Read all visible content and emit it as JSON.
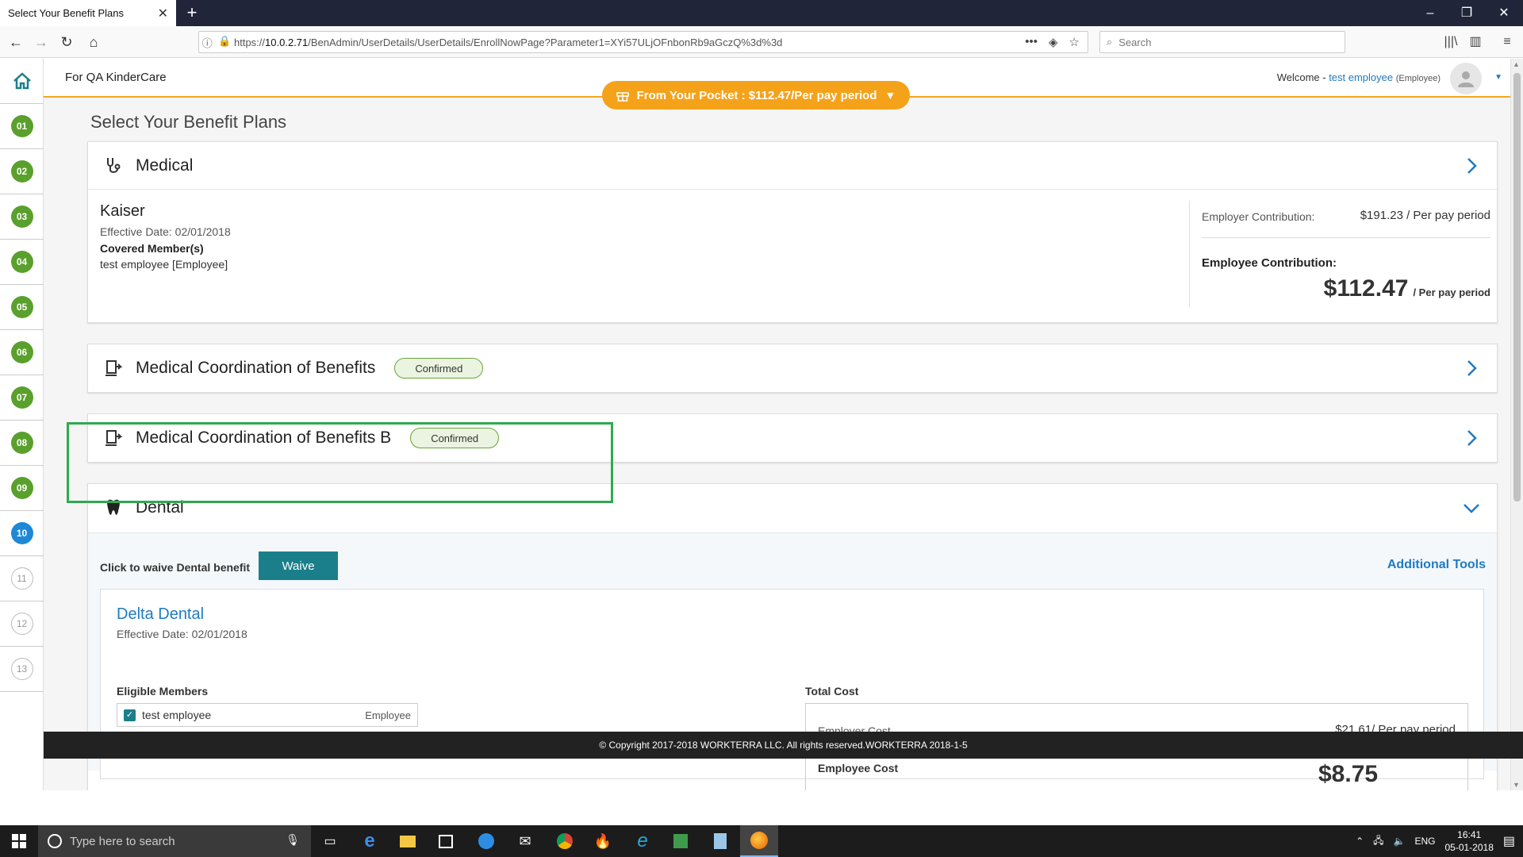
{
  "browser": {
    "tab_title": "Select Your Benefit Plans",
    "url_prefix": "https://",
    "url_host": "10.0.2.71",
    "url_path": "/BenAdmin/UserDetails/UserDetails/EnrollNowPage?Parameter1=XYi57ULjOFnbonRb9aGczQ%3d%3d",
    "search_placeholder": "Search"
  },
  "header": {
    "brand": "For QA KinderCare",
    "pocket_label": "From Your Pocket : $112.47/Per pay period",
    "welcome_prefix": "Welcome - ",
    "user_name": "test employee",
    "user_role": "(Employee)"
  },
  "steps": [
    {
      "label": "01",
      "state": "done"
    },
    {
      "label": "02",
      "state": "done"
    },
    {
      "label": "03",
      "state": "done"
    },
    {
      "label": "04",
      "state": "done"
    },
    {
      "label": "05",
      "state": "done"
    },
    {
      "label": "06",
      "state": "done"
    },
    {
      "label": "07",
      "state": "done"
    },
    {
      "label": "08",
      "state": "done"
    },
    {
      "label": "09",
      "state": "done"
    },
    {
      "label": "10",
      "state": "active"
    },
    {
      "label": "11",
      "state": "todo"
    },
    {
      "label": "12",
      "state": "todo"
    },
    {
      "label": "13",
      "state": "todo"
    }
  ],
  "page_title": "Select Your Benefit Plans",
  "medical": {
    "title": "Medical",
    "plan_name": "Kaiser",
    "effective_date": "Effective Date: 02/01/2018",
    "covered_label": "Covered Member(s)",
    "covered_value": "test employee [Employee]",
    "employer_label": "Employer Contribution:",
    "employer_value": "$191.23 / Per pay period",
    "employee_label": "Employee Contribution:",
    "employee_amount": "$112.47",
    "employee_per": "/ Per pay period"
  },
  "cob": {
    "title": "Medical Coordination of Benefits",
    "badge": "Confirmed"
  },
  "cob_b": {
    "title": "Medical Coordination of Benefits B",
    "badge": "Confirmed"
  },
  "dental": {
    "title": "Dental",
    "waive_label": "Click to waive Dental benefit",
    "waive_button": "Waive",
    "tools_link": "Additional Tools",
    "plan_name": "Delta Dental",
    "effective_date": "Effective Date: 02/01/2018",
    "eligible_label": "Eligible Members",
    "member_name": "test employee",
    "member_role": "Employee",
    "total_label": "Total Cost",
    "employer_cost_label": "Employer Cost",
    "employer_cost_value": "$21.61/ Per pay period",
    "employee_cost_label": "Employee Cost",
    "employee_cost_value": "$8.75"
  },
  "footer": "© Copyright 2017-2018 WORKTERRA LLC. All rights reserved.WORKTERRA 2018-1-5",
  "taskbar": {
    "search_placeholder": "Type here to search",
    "lang": "ENG",
    "time": "16:41",
    "date": "05-01-2018"
  },
  "colors": {
    "accent_orange": "#f5a21b",
    "step_done": "#5aa02c",
    "step_active": "#1e88d6",
    "teal_button": "#1a7f8a",
    "link_blue": "#1f7bc4",
    "highlight_green": "#2eaa4f"
  }
}
